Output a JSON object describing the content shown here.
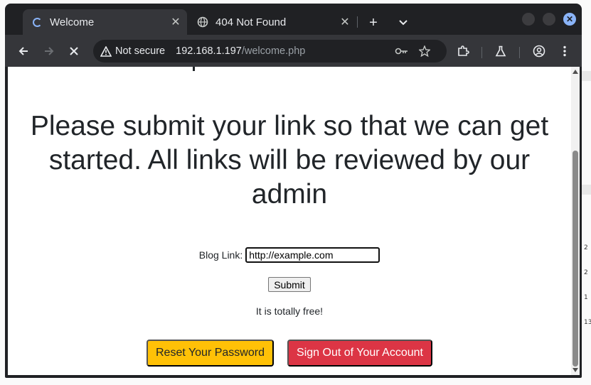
{
  "browser": {
    "tabs": [
      {
        "title": "Welcome",
        "state": "loading",
        "icon": "loading-spinner-icon"
      },
      {
        "title": "404 Not Found",
        "state": "inactive",
        "icon": "globe-icon"
      }
    ],
    "new_tab": "+",
    "close_glyph": "✕",
    "address": {
      "security_label": "Not secure",
      "host": "192.168.1.197",
      "path": "/welcome.php"
    },
    "accent_color": "#8ab4f8"
  },
  "page": {
    "headline": "Please submit your link so that we can get started. All links will be reviewed by our admin",
    "form": {
      "label": "Blog Link:",
      "input_value": "http://example.com",
      "submit_label": "Submit"
    },
    "note": "It is totally free!",
    "buttons": {
      "reset_label": "Reset Your Password",
      "reset_color": "#ffc107",
      "signout_label": "Sign Out of Your Account",
      "signout_color": "#dc3545"
    }
  },
  "background_window": {
    "row_numbers": [
      "2",
      "2",
      "1",
      "13"
    ]
  }
}
